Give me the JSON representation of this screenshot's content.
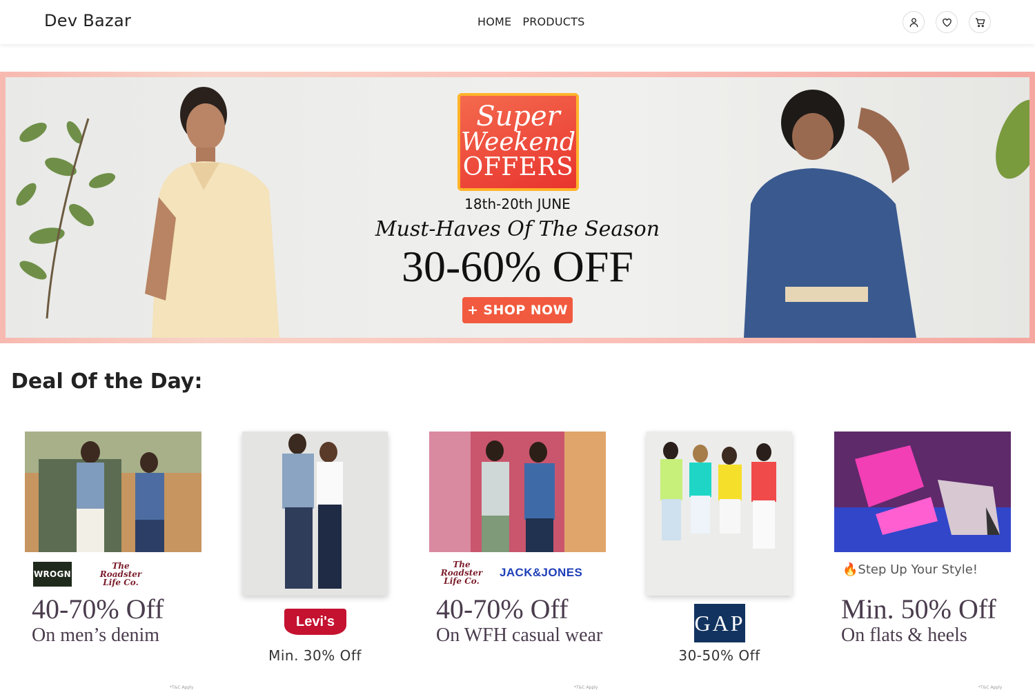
{
  "nav": {
    "brand": "Dev Bazar",
    "links": [
      "HOME",
      "PRODUCTS"
    ],
    "icons": [
      "user-icon",
      "heart-icon",
      "cart-icon"
    ]
  },
  "banner": {
    "badge": [
      "Super",
      "Weekend",
      "OFFERS"
    ],
    "date": "18th-20th JUNE",
    "tagline": "Must-Haves Of The Season",
    "offer": "30-60% OFF",
    "button": "+ SHOP NOW"
  },
  "deals": {
    "title": "Deal Of the Day:",
    "cards": [
      {
        "logos": [
          "WROGN",
          "The Roadster Life Co."
        ],
        "headline": "40-70% Off",
        "sub": "On men’s denim",
        "tc": "*T&C Apply"
      },
      {
        "logo": "Levi's",
        "offer": "Min. 30% Off"
      },
      {
        "logos": [
          "The Roadster Life Co.",
          "JACK&JONES"
        ],
        "headline": "40-70% Off",
        "sub": "On WFH casual wear",
        "tc": "*T&C Apply"
      },
      {
        "logo": "GAP",
        "offer": "30-50% Off"
      },
      {
        "kicker": "Step Up Your Style!",
        "headline": "Min. 50% Off",
        "sub": "On flats & heels",
        "tc": "*T&C Apply"
      }
    ]
  },
  "colors": {
    "accent": "#f15a3e",
    "badge_border": "#ffb42a",
    "levis": "#c41230",
    "gap": "#12335f"
  }
}
